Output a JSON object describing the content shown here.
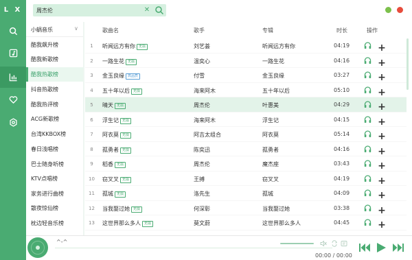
{
  "app": {
    "logo": "L X",
    "accent": "#4aab72"
  },
  "nav": [
    "search-icon",
    "playlist-icon",
    "leaderboard-icon",
    "heart-icon",
    "settings-icon"
  ],
  "search": {
    "value": "周杰伦"
  },
  "window": {
    "minimize_color": "#7cc04b",
    "close_color": "#e74c3c"
  },
  "source": {
    "label": "小蜗音乐"
  },
  "boards": [
    "酷我飙升榜",
    "酷我新歌榜",
    "酷我热歌榜",
    "抖音热歌榜",
    "酷我热评榜",
    "ACG新歌榜",
    "台湾KKBOX榜",
    "春日浅唱榜",
    "巴士随身听榜",
    "KTV点唱榜",
    "家务进行曲榜",
    "散夜惊仙榜",
    "枕边轻音乐榜"
  ],
  "active_board": 2,
  "columns": {
    "name": "歌曲名",
    "artist": "歌手",
    "album": "专辑",
    "duration": "时长",
    "action": "操作"
  },
  "songs": [
    {
      "no": "1",
      "name": "听闻远方有你",
      "tag": "无损",
      "artist": "刘艺荟",
      "album": "听闻远方有你",
      "duration": "04:19"
    },
    {
      "no": "2",
      "name": "一路生花",
      "tag": "无损",
      "artist": "温奕心",
      "album": "一路生花",
      "duration": "04:16"
    },
    {
      "no": "3",
      "name": "金玉良缘",
      "tag": "高品质",
      "artist": "付雪",
      "album": "金玉良缘",
      "duration": "03:27"
    },
    {
      "no": "4",
      "name": "五十年以后",
      "tag": "无损",
      "artist": "海来阿木",
      "album": "五十年以后",
      "duration": "05:10"
    },
    {
      "no": "5",
      "name": "晴天",
      "tag": "无损",
      "artist": "周杰伦",
      "album": "叶惠美",
      "duration": "04:29"
    },
    {
      "no": "6",
      "name": "浮生记",
      "tag": "无损",
      "artist": "海来阿木",
      "album": "浮生记",
      "duration": "04:15"
    },
    {
      "no": "7",
      "name": "阿衣莫",
      "tag": "无损",
      "artist": "阿吉太组合",
      "album": "阿衣莫",
      "duration": "05:14"
    },
    {
      "no": "8",
      "name": "孤勇者",
      "tag": "无损",
      "artist": "陈奕迅",
      "album": "孤勇者",
      "duration": "04:16"
    },
    {
      "no": "9",
      "name": "稻香",
      "tag": "无损",
      "artist": "周杰伦",
      "album": "魔杰座",
      "duration": "03:43"
    },
    {
      "no": "10",
      "name": "窃叉叉",
      "tag": "无损",
      "artist": "王搏",
      "album": "窃叉叉",
      "duration": "04:19"
    },
    {
      "no": "11",
      "name": "孤城",
      "tag": "无损",
      "artist": "洛先生",
      "album": "孤城",
      "duration": "04:09"
    },
    {
      "no": "12",
      "name": "当我娶过她",
      "tag": "无损",
      "artist": "何深彰",
      "album": "当我娶过她",
      "duration": "03:38"
    },
    {
      "no": "13",
      "name": "这世界那么多人",
      "tag": "无损",
      "artist": "莫文蔚",
      "album": "这世界那么多人",
      "duration": "04:45"
    }
  ],
  "highlight_row": 4,
  "player": {
    "title": "^-^",
    "time": "00:00 / 00:00",
    "progress": 0
  }
}
